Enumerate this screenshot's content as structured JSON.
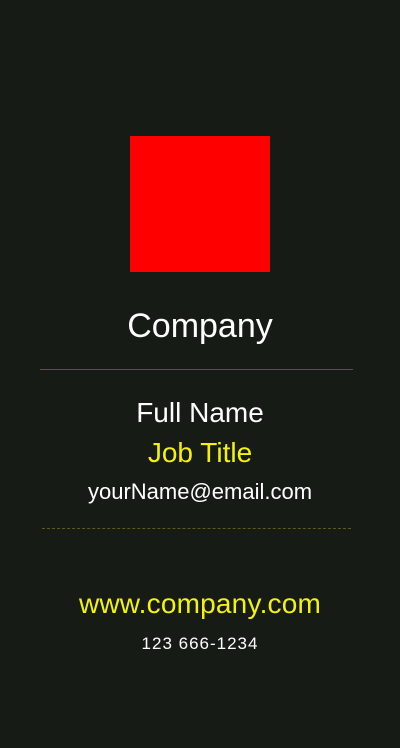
{
  "card": {
    "company": "Company",
    "full_name": "Full Name",
    "job_title": "Job Title",
    "email": "yourName@email.com",
    "website": "www.company.com",
    "phone": "123 666-1234"
  },
  "colors": {
    "background": "#161c15",
    "logo": "#ff0000",
    "accent": "#f2f20d",
    "text": "#ffffff",
    "divider": "#5d5a1a"
  }
}
